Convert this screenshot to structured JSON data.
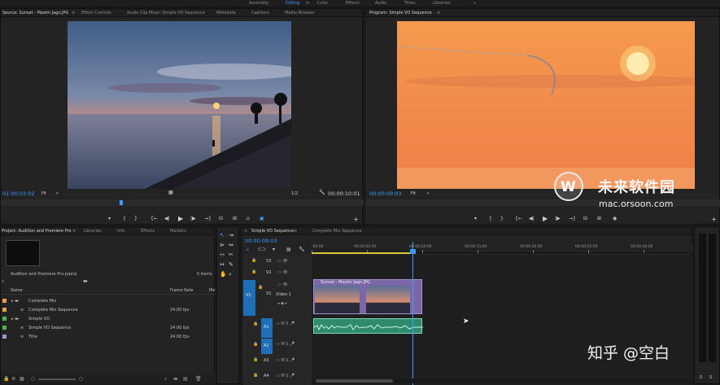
{
  "workspaces": {
    "assembly": "Assembly",
    "editing": "Editing",
    "color": "Color",
    "effects": "Effects",
    "audio": "Audio",
    "titles": "Titles",
    "libraries": "Libraries"
  },
  "source_panel": {
    "tabs": [
      "Source: Sunset - Maxim Jago.JPG",
      "Effect Controls",
      "Audio Clip Mixer: Simple VO Sequence",
      "Metadata",
      "Captions",
      "Media Browser"
    ],
    "timecode": "01:00:03:02",
    "fit": "Fit",
    "quality": "1/2",
    "duration": "00:00:10:01"
  },
  "program_panel": {
    "title": "Program: Simple VO Sequence",
    "timecode": "00:00:09:03",
    "fit": "Fit"
  },
  "project_panel": {
    "tabs": [
      "Project: Audition and Premiere Pro",
      "Libraries",
      "Info",
      "Effects",
      "Markers"
    ],
    "filename": "Audition and Premiere Pro.prproj",
    "item_count": "5 items",
    "columns": {
      "name": "Name",
      "frame_rate": "Frame Rate",
      "media": "Me"
    },
    "items": [
      {
        "name": "Complete Mix",
        "fps": "",
        "color": "#e8a13c"
      },
      {
        "name": "Complete Mix Sequence",
        "fps": "24.00 fps",
        "color": "#e8a13c"
      },
      {
        "name": "Simple VO",
        "fps": "",
        "color": "#4fb24f"
      },
      {
        "name": "Simple VO Sequence",
        "fps": "24.00 fps",
        "color": "#4fb24f"
      },
      {
        "name": "Title",
        "fps": "24.00 fps",
        "color": "#a98bd6"
      }
    ]
  },
  "timeline": {
    "tabs": [
      "Simple VO Sequence",
      "Complete Mix Sequence"
    ],
    "timecode": "00:00:09:03",
    "ruler": [
      ":00:00",
      "00:00:05:00",
      "00:00:10:00",
      "00:00:15:00",
      "00:00:20:00",
      "00:00:25:00",
      "00:00:30:00"
    ],
    "tracks": {
      "v3": "V3",
      "v2": "V2",
      "v1": "V1",
      "v1_label": "Video 1",
      "a1": "A1",
      "a2": "A2",
      "a3": "A3",
      "a4": "A4"
    },
    "clip_name": "Sunset - Maxim Jago.JPG",
    "source_v1": "V1",
    "source_a1": "A1"
  },
  "watermark": {
    "brand": "未来软件园",
    "site": "mac.orsoon.com",
    "credit": "知乎 @空白"
  },
  "icons": [
    "play-icon",
    "step-back-icon",
    "step-forward-icon",
    "mark-in-icon",
    "mark-out-icon",
    "wrench-icon",
    "camera-icon",
    "add-icon",
    "selection-tool-icon",
    "razor-tool-icon",
    "hand-tool-icon",
    "zoom-tool-icon",
    "folder-icon",
    "search-icon"
  ]
}
